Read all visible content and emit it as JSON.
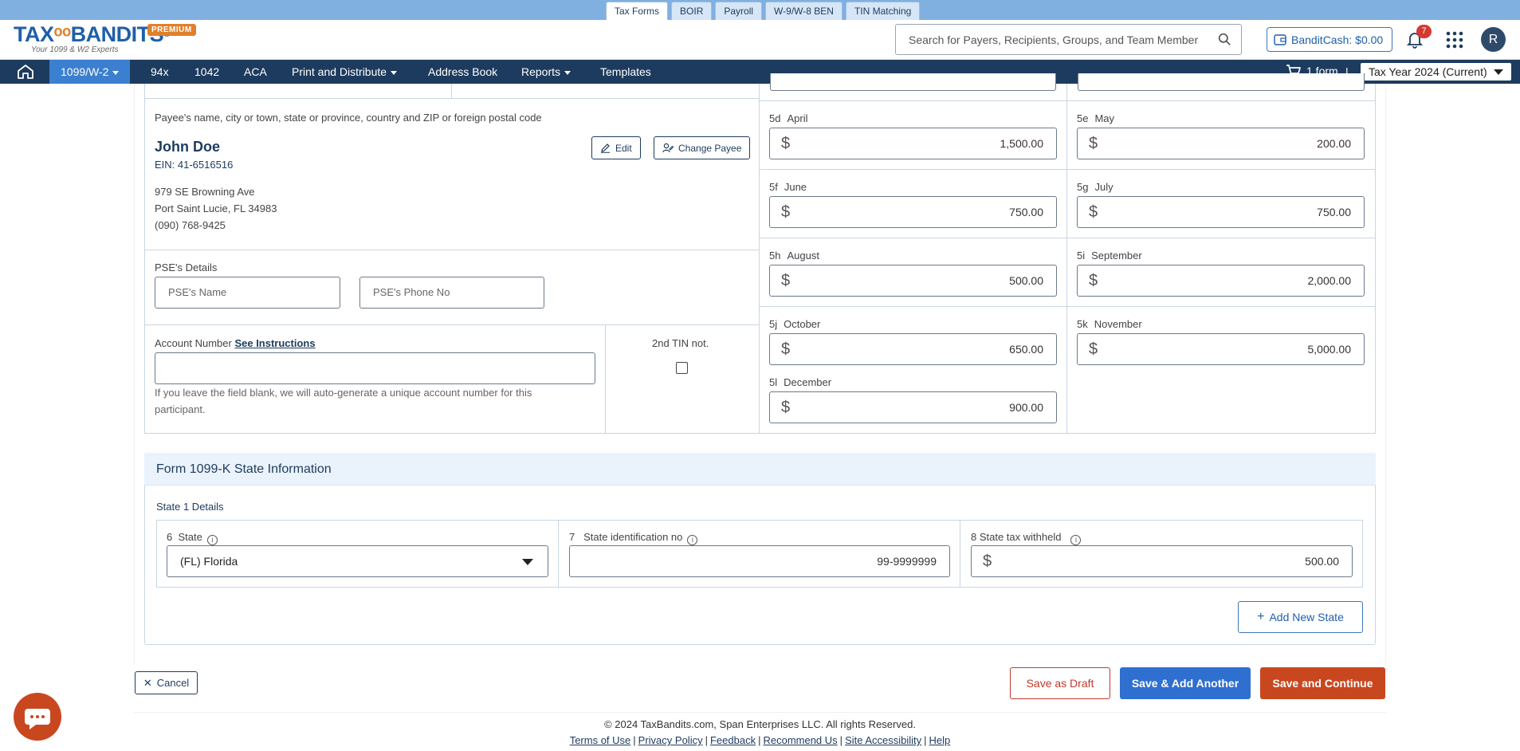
{
  "product_tabs": [
    "Tax Forms",
    "BOIR",
    "Payroll",
    "W-9/W-8 BEN",
    "TIN Matching"
  ],
  "header": {
    "logo_text_1": "TAX",
    "logo_text_2": "BANDITS",
    "logo_reg": "®",
    "logo_tagline": "Your 1099 & W2 Experts",
    "premium_badge": "PREMIUM",
    "search_placeholder": "Search for Payers, Recipients, Groups, and Team Members",
    "bandit_cash": "BanditCash: $0.00",
    "notification_count": "7",
    "avatar_initial": "R"
  },
  "nav": {
    "items": [
      "1099/W-2",
      "94x",
      "1042",
      "ACA",
      "Print and Distribute",
      "Address Book",
      "Reports",
      "Templates"
    ],
    "cart_label": "1 form",
    "separator": "|",
    "tax_year": "Tax Year 2024 (Current)"
  },
  "payee": {
    "section_label": "Payee's name, city or town, state or province, country and ZIP or foreign postal code",
    "name": "John Doe",
    "ein": "EIN: 41-6516516",
    "address_line1": "979 SE Browning Ave",
    "address_line2": "Port Saint Lucie, FL 34983",
    "phone": "(090) 768-9425",
    "edit_label": "Edit",
    "change_label": "Change Payee"
  },
  "pse": {
    "label": "PSE's Details",
    "name_placeholder": "PSE's Name",
    "phone_placeholder": "PSE's Phone No"
  },
  "account": {
    "label": "Account Number",
    "instructions_link": "See Instructions",
    "value": "",
    "hint": "If you leave the field blank, we will auto-generate a unique account number for this participant.",
    "tin_label": "2nd TIN not."
  },
  "months": [
    {
      "code": "5d",
      "name": "April",
      "value": "1,500.00"
    },
    {
      "code": "5e",
      "name": "May",
      "value": "200.00"
    },
    {
      "code": "5f",
      "name": "June",
      "value": "750.00"
    },
    {
      "code": "5g",
      "name": "July",
      "value": "750.00"
    },
    {
      "code": "5h",
      "name": "August",
      "value": "500.00"
    },
    {
      "code": "5i",
      "name": "September",
      "value": "2,000.00"
    },
    {
      "code": "5j",
      "name": "October",
      "value": "650.00"
    },
    {
      "code": "5k",
      "name": "November",
      "value": "5,000.00"
    },
    {
      "code": "5l",
      "name": "December",
      "value": "900.00"
    }
  ],
  "currency_symbol": "$",
  "state_section": {
    "title": "Form 1099-K  State Information",
    "state1_label": "State 1 Details",
    "state_label_code": "6",
    "state_label": "State",
    "state_value": "(FL) Florida",
    "state_id_code": "7",
    "state_id_label": "State identification no",
    "state_id_value": "99-9999999",
    "tax_withheld_label": "8 State tax withheld",
    "tax_withheld_value": "500.00",
    "add_state": "Add New State"
  },
  "actions": {
    "cancel": "Cancel",
    "save_draft": "Save as Draft",
    "save_add": "Save & Add Another",
    "save_continue": "Save and Continue"
  },
  "footer": {
    "copyright": "© 2024 TaxBandits.com, Span Enterprises LLC. All rights Reserved.",
    "links": [
      "Terms of Use",
      "Privacy Policy",
      "Feedback",
      "Recommend Us",
      "Site Accessibility",
      "Help"
    ]
  },
  "colors": {
    "navy": "#1d3b5e",
    "accent_blue": "#2f6fcf",
    "accent_orange": "#c9471f",
    "topbar": "#7fb0e0"
  }
}
